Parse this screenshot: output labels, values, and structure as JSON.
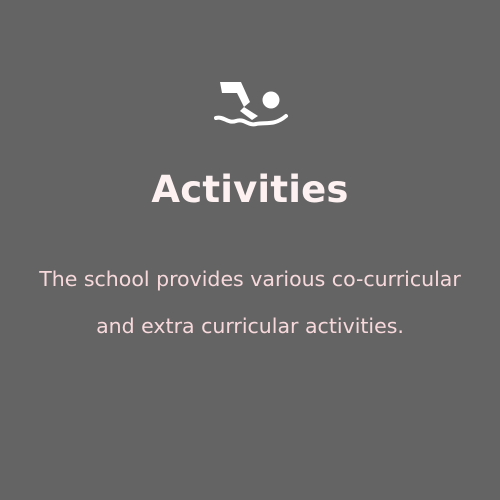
{
  "section": {
    "icon": "swimmer-icon",
    "title": "Activities",
    "description_line_1": "The school provides various co-curricular",
    "description_line_2": "and extra curricular activities."
  },
  "colors": {
    "background": "#646464",
    "title": "#fdf1f1",
    "text": "#f7d9dc",
    "icon": "#ffffff"
  }
}
